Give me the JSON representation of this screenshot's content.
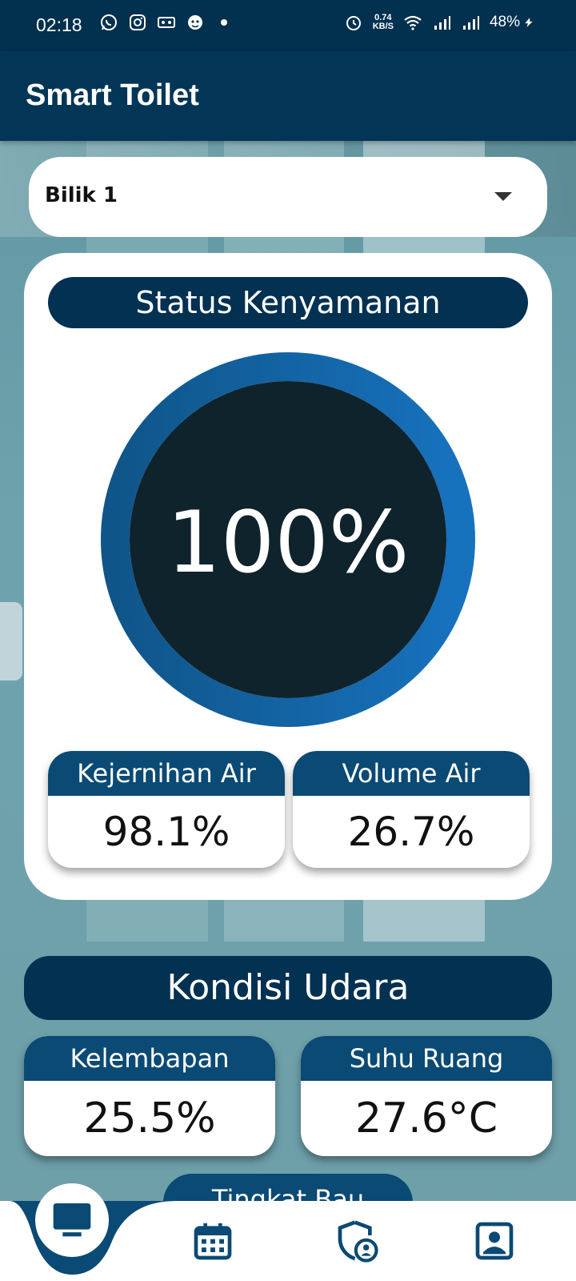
{
  "status_bar": {
    "time": "02:18",
    "net_speed_value": "0.74",
    "net_speed_unit": "KB/S",
    "battery": "48%"
  },
  "app_bar": {
    "title": "Smart Toilet"
  },
  "selector": {
    "selected": "Bilik 1"
  },
  "comfort": {
    "header": "Status Kenyamanan",
    "gauge_value": "100%",
    "gauge_fraction": 1.0,
    "water_clarity": {
      "label": "Kejernihan Air",
      "value": "98.1%"
    },
    "water_volume": {
      "label": "Volume Air",
      "value": "26.7%"
    }
  },
  "air": {
    "header": "Kondisi Udara",
    "humidity": {
      "label": "Kelembapan",
      "value": "25.5%"
    },
    "temperature": {
      "label": "Suhu Ruang",
      "value": "27.6°C"
    },
    "odor_label": "Tingkat Bau"
  },
  "colors": {
    "primary_dark": "#023152",
    "header_blue": "#0a4a74",
    "gauge_ring": "#1468a6",
    "gauge_center": "#0f232c"
  },
  "nav": {
    "items": [
      "monitor-icon",
      "calendar-icon",
      "shield-user-icon",
      "profile-icon"
    ],
    "active": "monitor-icon"
  }
}
